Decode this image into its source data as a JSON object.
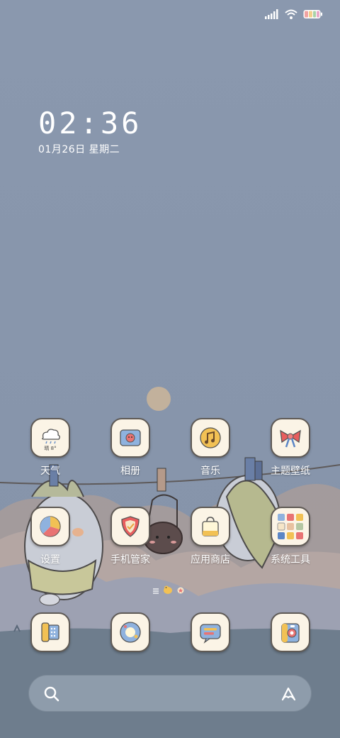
{
  "status_bar": {
    "icons": [
      "signal-icon",
      "wifi-icon",
      "battery-icon"
    ]
  },
  "clock": {
    "time": "02:36",
    "date": "01月26日 星期二"
  },
  "apps_row1": [
    {
      "label": "天气",
      "icon": "weather-icon",
      "weather": "晴 8°"
    },
    {
      "label": "相册",
      "icon": "gallery-icon"
    },
    {
      "label": "音乐",
      "icon": "music-icon"
    },
    {
      "label": "主题壁纸",
      "icon": "theme-icon"
    }
  ],
  "apps_row2": [
    {
      "label": "设置",
      "icon": "settings-icon"
    },
    {
      "label": "手机管家",
      "icon": "security-icon"
    },
    {
      "label": "应用商店",
      "icon": "app-store-icon"
    },
    {
      "label": "系统工具",
      "icon": "system-tools-folder-icon"
    }
  ],
  "dock": [
    {
      "icon": "phone-icon"
    },
    {
      "icon": "browser-icon"
    },
    {
      "icon": "messages-icon"
    },
    {
      "icon": "camera-icon"
    }
  ],
  "search_bar": {
    "icons": [
      "search-icon",
      "assistant-icon"
    ]
  },
  "colors": {
    "wallpaper": "#8796ad",
    "icon_bg": "#fbf4e6",
    "icon_border": "#5f5a55"
  }
}
